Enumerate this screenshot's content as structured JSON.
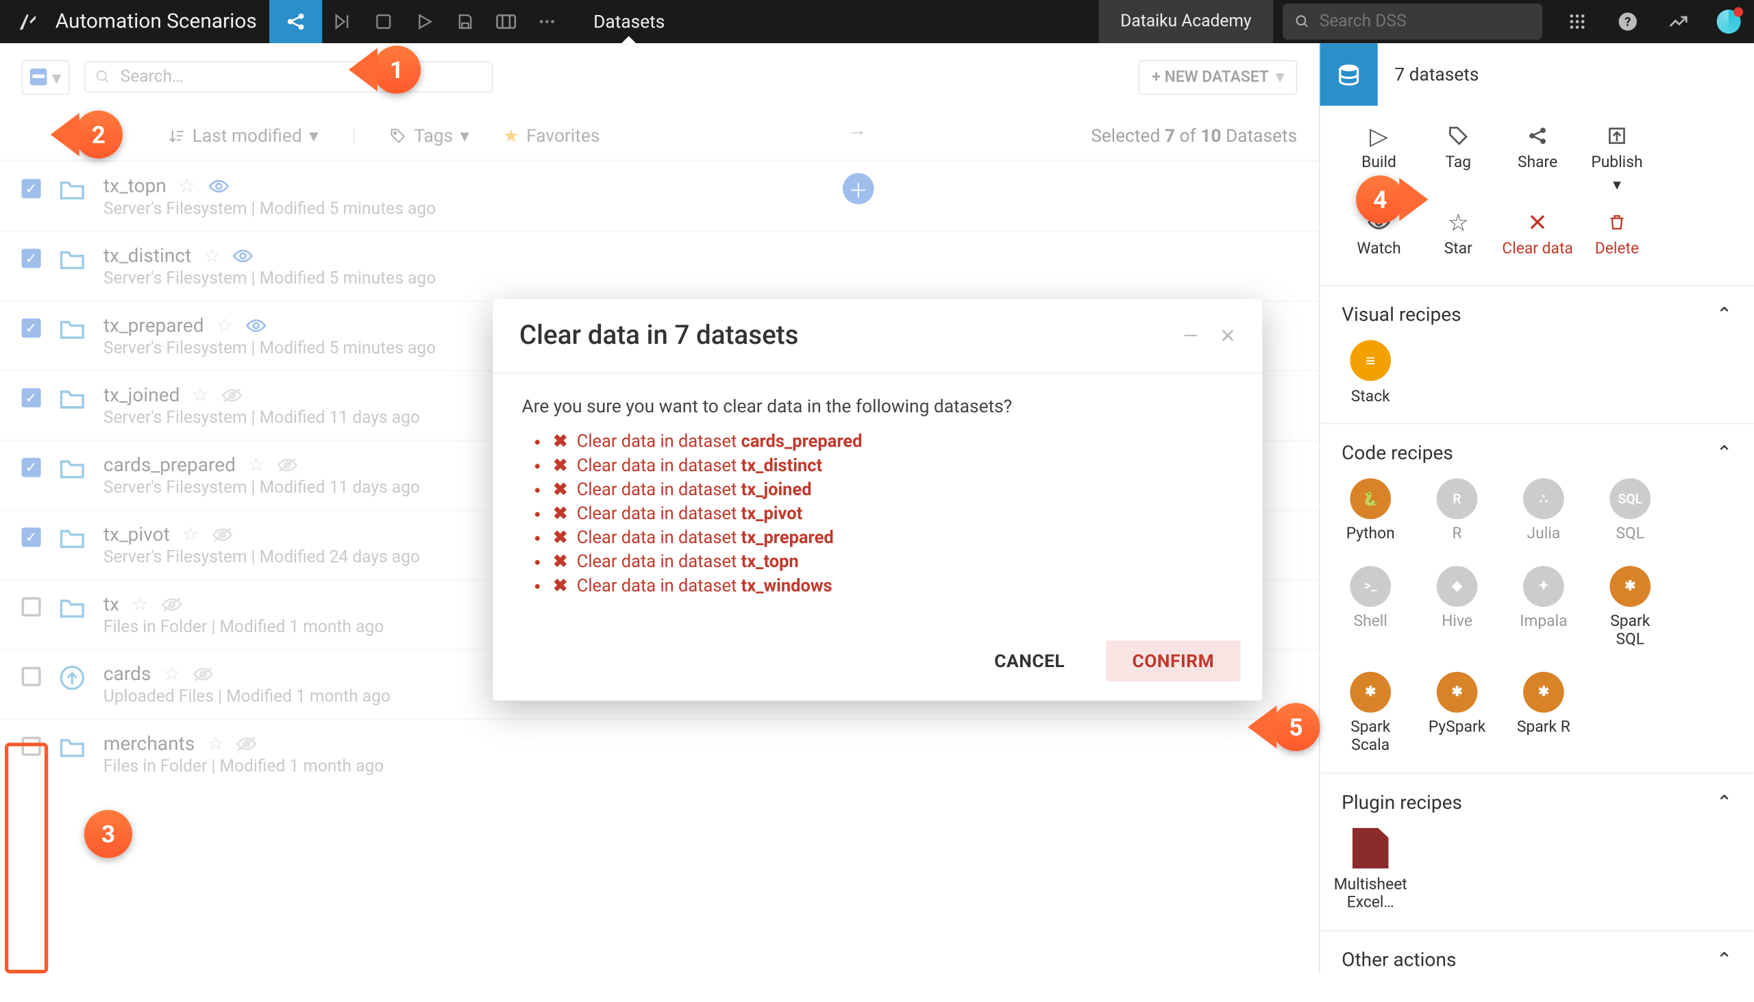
{
  "topnav": {
    "title": "Automation Scenarios",
    "tab": "Datasets",
    "academy": "Dataiku Academy",
    "search_placeholder": "Search DSS"
  },
  "toolbar": {
    "search_placeholder": "Search…",
    "new_dataset": "+ NEW DATASET"
  },
  "filterbar": {
    "last_modified": "Last modified",
    "tags": "Tags",
    "favorites": "Favorites",
    "selection": "Selected 7 of 10 Datasets"
  },
  "rows": [
    {
      "checked": true,
      "kind": "folder-blue",
      "name": "tx_topn",
      "meta": "Server's Filesystem | Modified 5 minutes ago",
      "eye": "blue"
    },
    {
      "checked": true,
      "kind": "folder-blue",
      "name": "tx_distinct",
      "meta": "Server's Filesystem | Modified 5 minutes ago",
      "eye": "blue"
    },
    {
      "checked": true,
      "kind": "folder-blue",
      "name": "tx_prepared",
      "meta": "Server's Filesystem | Modified 5 minutes ago",
      "eye": "blue"
    },
    {
      "checked": true,
      "kind": "folder-blue",
      "name": "tx_joined",
      "meta": "Server's Filesystem | Modified 11 days ago",
      "eye": "grey"
    },
    {
      "checked": true,
      "kind": "folder-blue",
      "name": "cards_prepared",
      "meta": "Server's Filesystem | Modified 11 days ago",
      "eye": "grey"
    },
    {
      "checked": true,
      "kind": "folder-blue",
      "name": "tx_pivot",
      "meta": "Server's Filesystem | Modified 24 days ago",
      "eye": "grey"
    },
    {
      "checked": false,
      "kind": "folder-blue",
      "name": "tx",
      "meta": "Files in Folder | Modified 1 month ago",
      "eye": "grey"
    },
    {
      "checked": false,
      "kind": "upload",
      "name": "cards",
      "meta": "Uploaded Files | Modified 1 month ago",
      "eye": "grey"
    },
    {
      "checked": false,
      "kind": "folder-blue",
      "name": "merchants",
      "meta": "Files in Folder | Modified 1 month ago",
      "eye": "grey"
    }
  ],
  "modal": {
    "title": "Clear data in 7 datasets",
    "question": "Are you sure you want to clear data in the following datasets?",
    "prefix": "Clear data in dataset ",
    "items": [
      "cards_prepared",
      "tx_distinct",
      "tx_joined",
      "tx_pivot",
      "tx_prepared",
      "tx_topn",
      "tx_windows"
    ],
    "cancel": "CANCEL",
    "confirm": "CONFIRM"
  },
  "rightpanel": {
    "title": "7 datasets",
    "actions": {
      "build": "Build",
      "tag": "Tag",
      "share": "Share",
      "publish": "Publish",
      "watch": "Watch",
      "star": "Star",
      "clear": "Clear data",
      "delete": "Delete"
    },
    "sections": {
      "visual": "Visual recipes",
      "code": "Code recipes",
      "plugin": "Plugin recipes",
      "other": "Other actions"
    },
    "visual_items": [
      {
        "name": "Stack",
        "color": "#f2a100"
      }
    ],
    "code_items": [
      {
        "name": "Python",
        "color": "#d98328"
      },
      {
        "name": "R",
        "color": "#cfcfcf"
      },
      {
        "name": "Julia",
        "color": "#cfcfcf"
      },
      {
        "name": "SQL",
        "color": "#cfcfcf"
      },
      {
        "name": "Shell",
        "color": "#cfcfcf"
      },
      {
        "name": "Hive",
        "color": "#cfcfcf"
      },
      {
        "name": "Impala",
        "color": "#cfcfcf"
      },
      {
        "name": "Spark SQL",
        "color": "#d98328"
      },
      {
        "name": "Spark Scala",
        "color": "#d98328"
      },
      {
        "name": "PySpark",
        "color": "#d98328"
      },
      {
        "name": "Spark R",
        "color": "#d98328"
      }
    ],
    "plugin_items": [
      {
        "name": "Multisheet Excel…"
      }
    ]
  },
  "callouts": {
    "1": "1",
    "2": "2",
    "3": "3",
    "4": "4",
    "5": "5"
  }
}
